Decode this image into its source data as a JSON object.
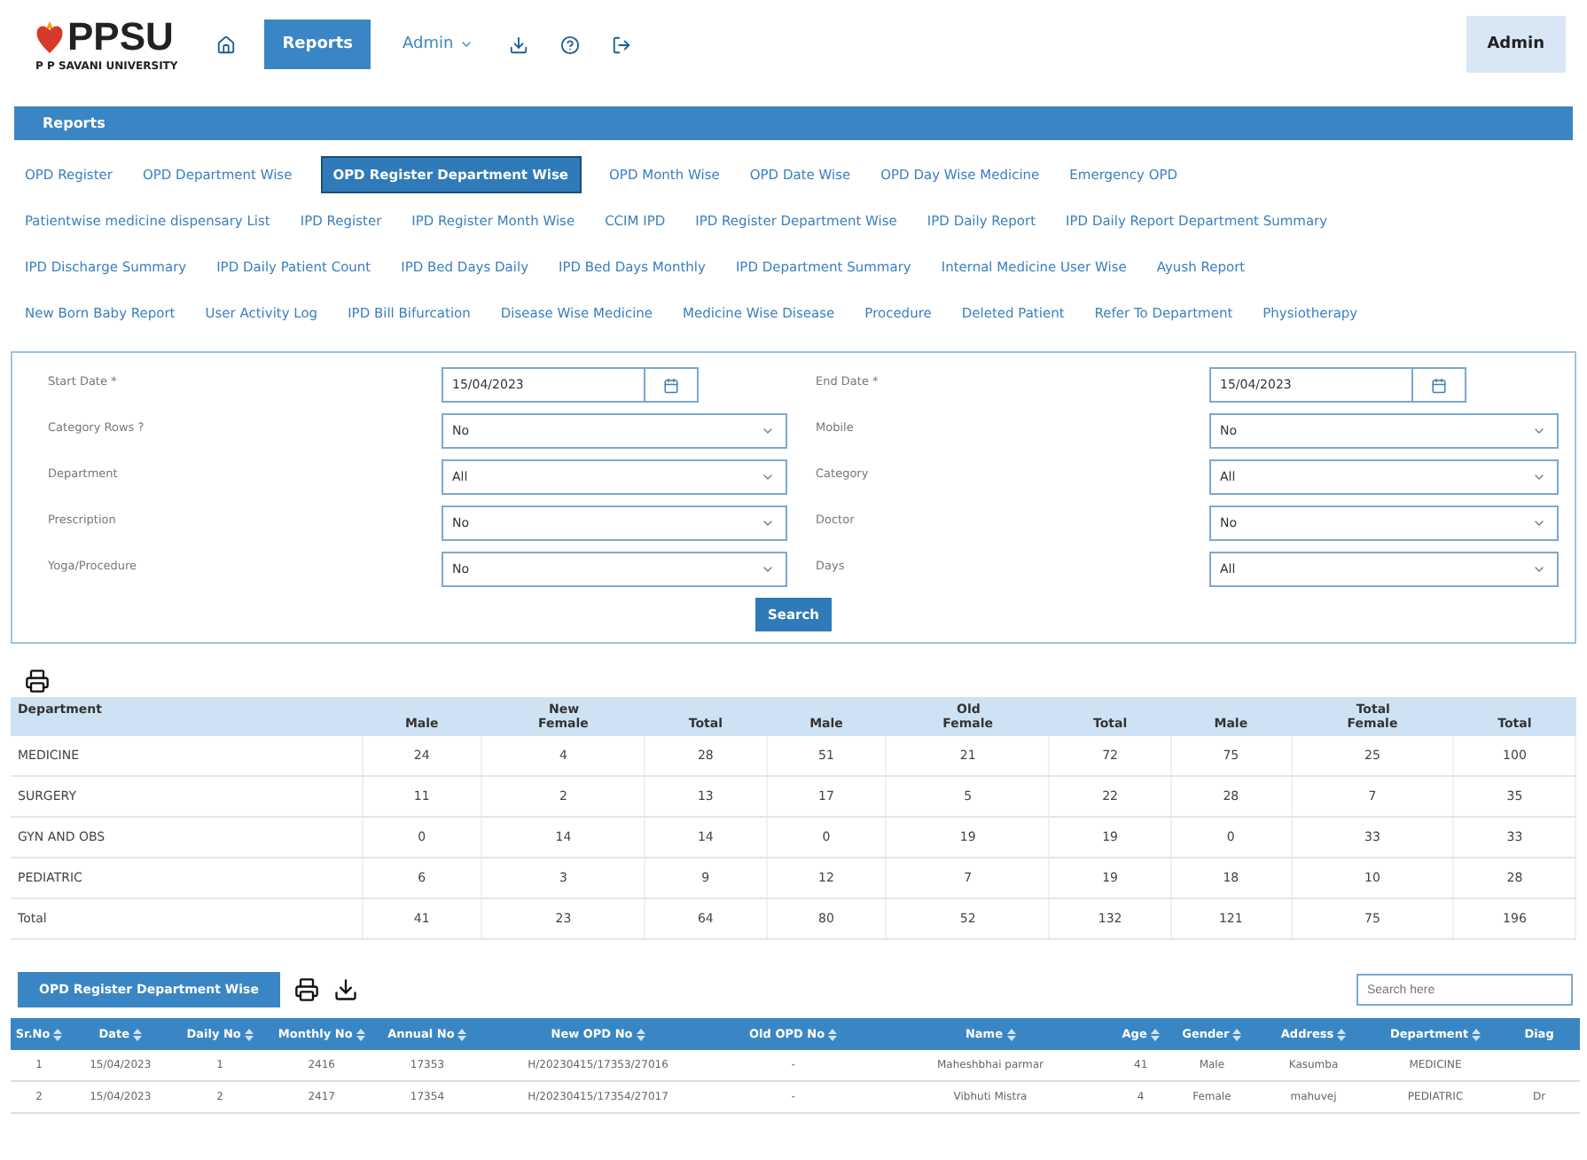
{
  "header": {
    "logo_text": "PPSU",
    "logo_subtitle": "P P SAVANI UNIVERSITY",
    "nav": [
      {
        "kind": "home",
        "selected": false
      },
      {
        "kind": "text",
        "label": "Reports",
        "selected": true
      },
      {
        "kind": "dropdown",
        "label": "Admin",
        "selected": false
      },
      {
        "kind": "download",
        "selected": false
      },
      {
        "kind": "help",
        "selected": false
      },
      {
        "kind": "logout",
        "selected": false
      }
    ],
    "user": "Admin"
  },
  "section_title": "Reports",
  "report_links": [
    [
      {
        "label": "OPD Register",
        "selected": false
      },
      {
        "label": "OPD Department Wise",
        "selected": false
      },
      {
        "label": "OPD Register Department Wise",
        "selected": true
      },
      {
        "label": "OPD Month Wise",
        "selected": false
      },
      {
        "label": "OPD Date Wise",
        "selected": false
      },
      {
        "label": "OPD Day Wise Medicine",
        "selected": false
      },
      {
        "label": "Emergency OPD",
        "selected": false
      }
    ],
    [
      {
        "label": "Patientwise medicine dispensary List",
        "selected": false
      },
      {
        "label": "IPD Register",
        "selected": false
      },
      {
        "label": "IPD Register Month Wise",
        "selected": false
      },
      {
        "label": "CCIM IPD",
        "selected": false
      },
      {
        "label": "IPD Register Department Wise",
        "selected": false
      },
      {
        "label": "IPD Daily Report",
        "selected": false
      },
      {
        "label": "IPD Daily Report Department Summary",
        "selected": false
      }
    ],
    [
      {
        "label": "IPD Discharge Summary",
        "selected": false
      },
      {
        "label": "IPD Daily Patient Count",
        "selected": false
      },
      {
        "label": "IPD Bed Days Daily",
        "selected": false
      },
      {
        "label": "IPD Bed Days Monthly",
        "selected": false
      },
      {
        "label": "IPD Department Summary",
        "selected": false
      },
      {
        "label": "Internal Medicine User Wise",
        "selected": false
      },
      {
        "label": "Ayush Report",
        "selected": false
      }
    ],
    [
      {
        "label": "New Born Baby Report",
        "selected": false
      },
      {
        "label": "User Activity Log",
        "selected": false
      },
      {
        "label": "IPD Bill Bifurcation",
        "selected": false
      },
      {
        "label": "Disease Wise Medicine",
        "selected": false
      },
      {
        "label": "Medicine Wise Disease",
        "selected": false
      },
      {
        "label": "Procedure",
        "selected": false
      },
      {
        "label": "Deleted Patient",
        "selected": false
      },
      {
        "label": "Refer To Department",
        "selected": false
      },
      {
        "label": "Physiotherapy",
        "selected": false
      }
    ]
  ],
  "filters": [
    {
      "label": "Start Date *",
      "kind": "date",
      "value": "15/04/2023"
    },
    {
      "label": "End Date *",
      "kind": "date",
      "value": "15/04/2023"
    },
    {
      "label": "Category Rows ?",
      "kind": "select",
      "value": "No"
    },
    {
      "label": "Mobile",
      "kind": "select",
      "value": "No"
    },
    {
      "label": "Department",
      "kind": "select",
      "value": "All"
    },
    {
      "label": "Category",
      "kind": "select",
      "value": "All"
    },
    {
      "label": "Prescription",
      "kind": "select",
      "value": "No"
    },
    {
      "label": "Doctor",
      "kind": "select",
      "value": "No"
    },
    {
      "label": "Yoga/Procedure",
      "kind": "select",
      "value": "No"
    },
    {
      "label": "Days",
      "kind": "select",
      "value": "All"
    }
  ],
  "search_button": "Search",
  "summary_table": {
    "first_column": "Department",
    "groups": [
      {
        "title": "New",
        "columns": [
          "Male",
          "Female",
          "Total"
        ]
      },
      {
        "title": "Old",
        "columns": [
          "Male",
          "Female",
          "Total"
        ]
      },
      {
        "title": "Total",
        "columns": [
          "Male",
          "Female",
          "Total"
        ]
      }
    ],
    "rows": [
      [
        "MEDICINE",
        "24",
        "4",
        "28",
        "51",
        "21",
        "72",
        "75",
        "25",
        "100"
      ],
      [
        "SURGERY",
        "11",
        "2",
        "13",
        "17",
        "5",
        "22",
        "28",
        "7",
        "35"
      ],
      [
        "GYN AND OBS",
        "0",
        "14",
        "14",
        "0",
        "19",
        "19",
        "0",
        "33",
        "33"
      ],
      [
        "PEDIATRIC",
        "6",
        "3",
        "9",
        "12",
        "7",
        "19",
        "18",
        "10",
        "28"
      ],
      [
        "Total",
        "41",
        "23",
        "64",
        "80",
        "52",
        "132",
        "121",
        "75",
        "196"
      ]
    ]
  },
  "register": {
    "title": "OPD Register Department Wise",
    "search": {
      "placeholder": "Search here"
    },
    "columns": [
      "Sr.No",
      "Date",
      "Daily No",
      "Monthly No",
      "Annual No",
      "New OPD No",
      "Old OPD No",
      "Name",
      "Age",
      "Gender",
      "Address",
      "Department",
      "Diag"
    ],
    "rows": [
      [
        "1",
        "15/04/2023",
        "1",
        "2416",
        "17353",
        "H/20230415/17353/27016",
        "-",
        "Maheshbhai parmar",
        "41",
        "Male",
        "Kasumba",
        "MEDICINE",
        ""
      ],
      [
        "2",
        "15/04/2023",
        "2",
        "2417",
        "17354",
        "H/20230415/17354/27017",
        "-",
        "Vibhuti Mistra",
        "4",
        "Female",
        "mahuvej",
        "PEDIATRIC",
        "Dr"
      ]
    ]
  }
}
